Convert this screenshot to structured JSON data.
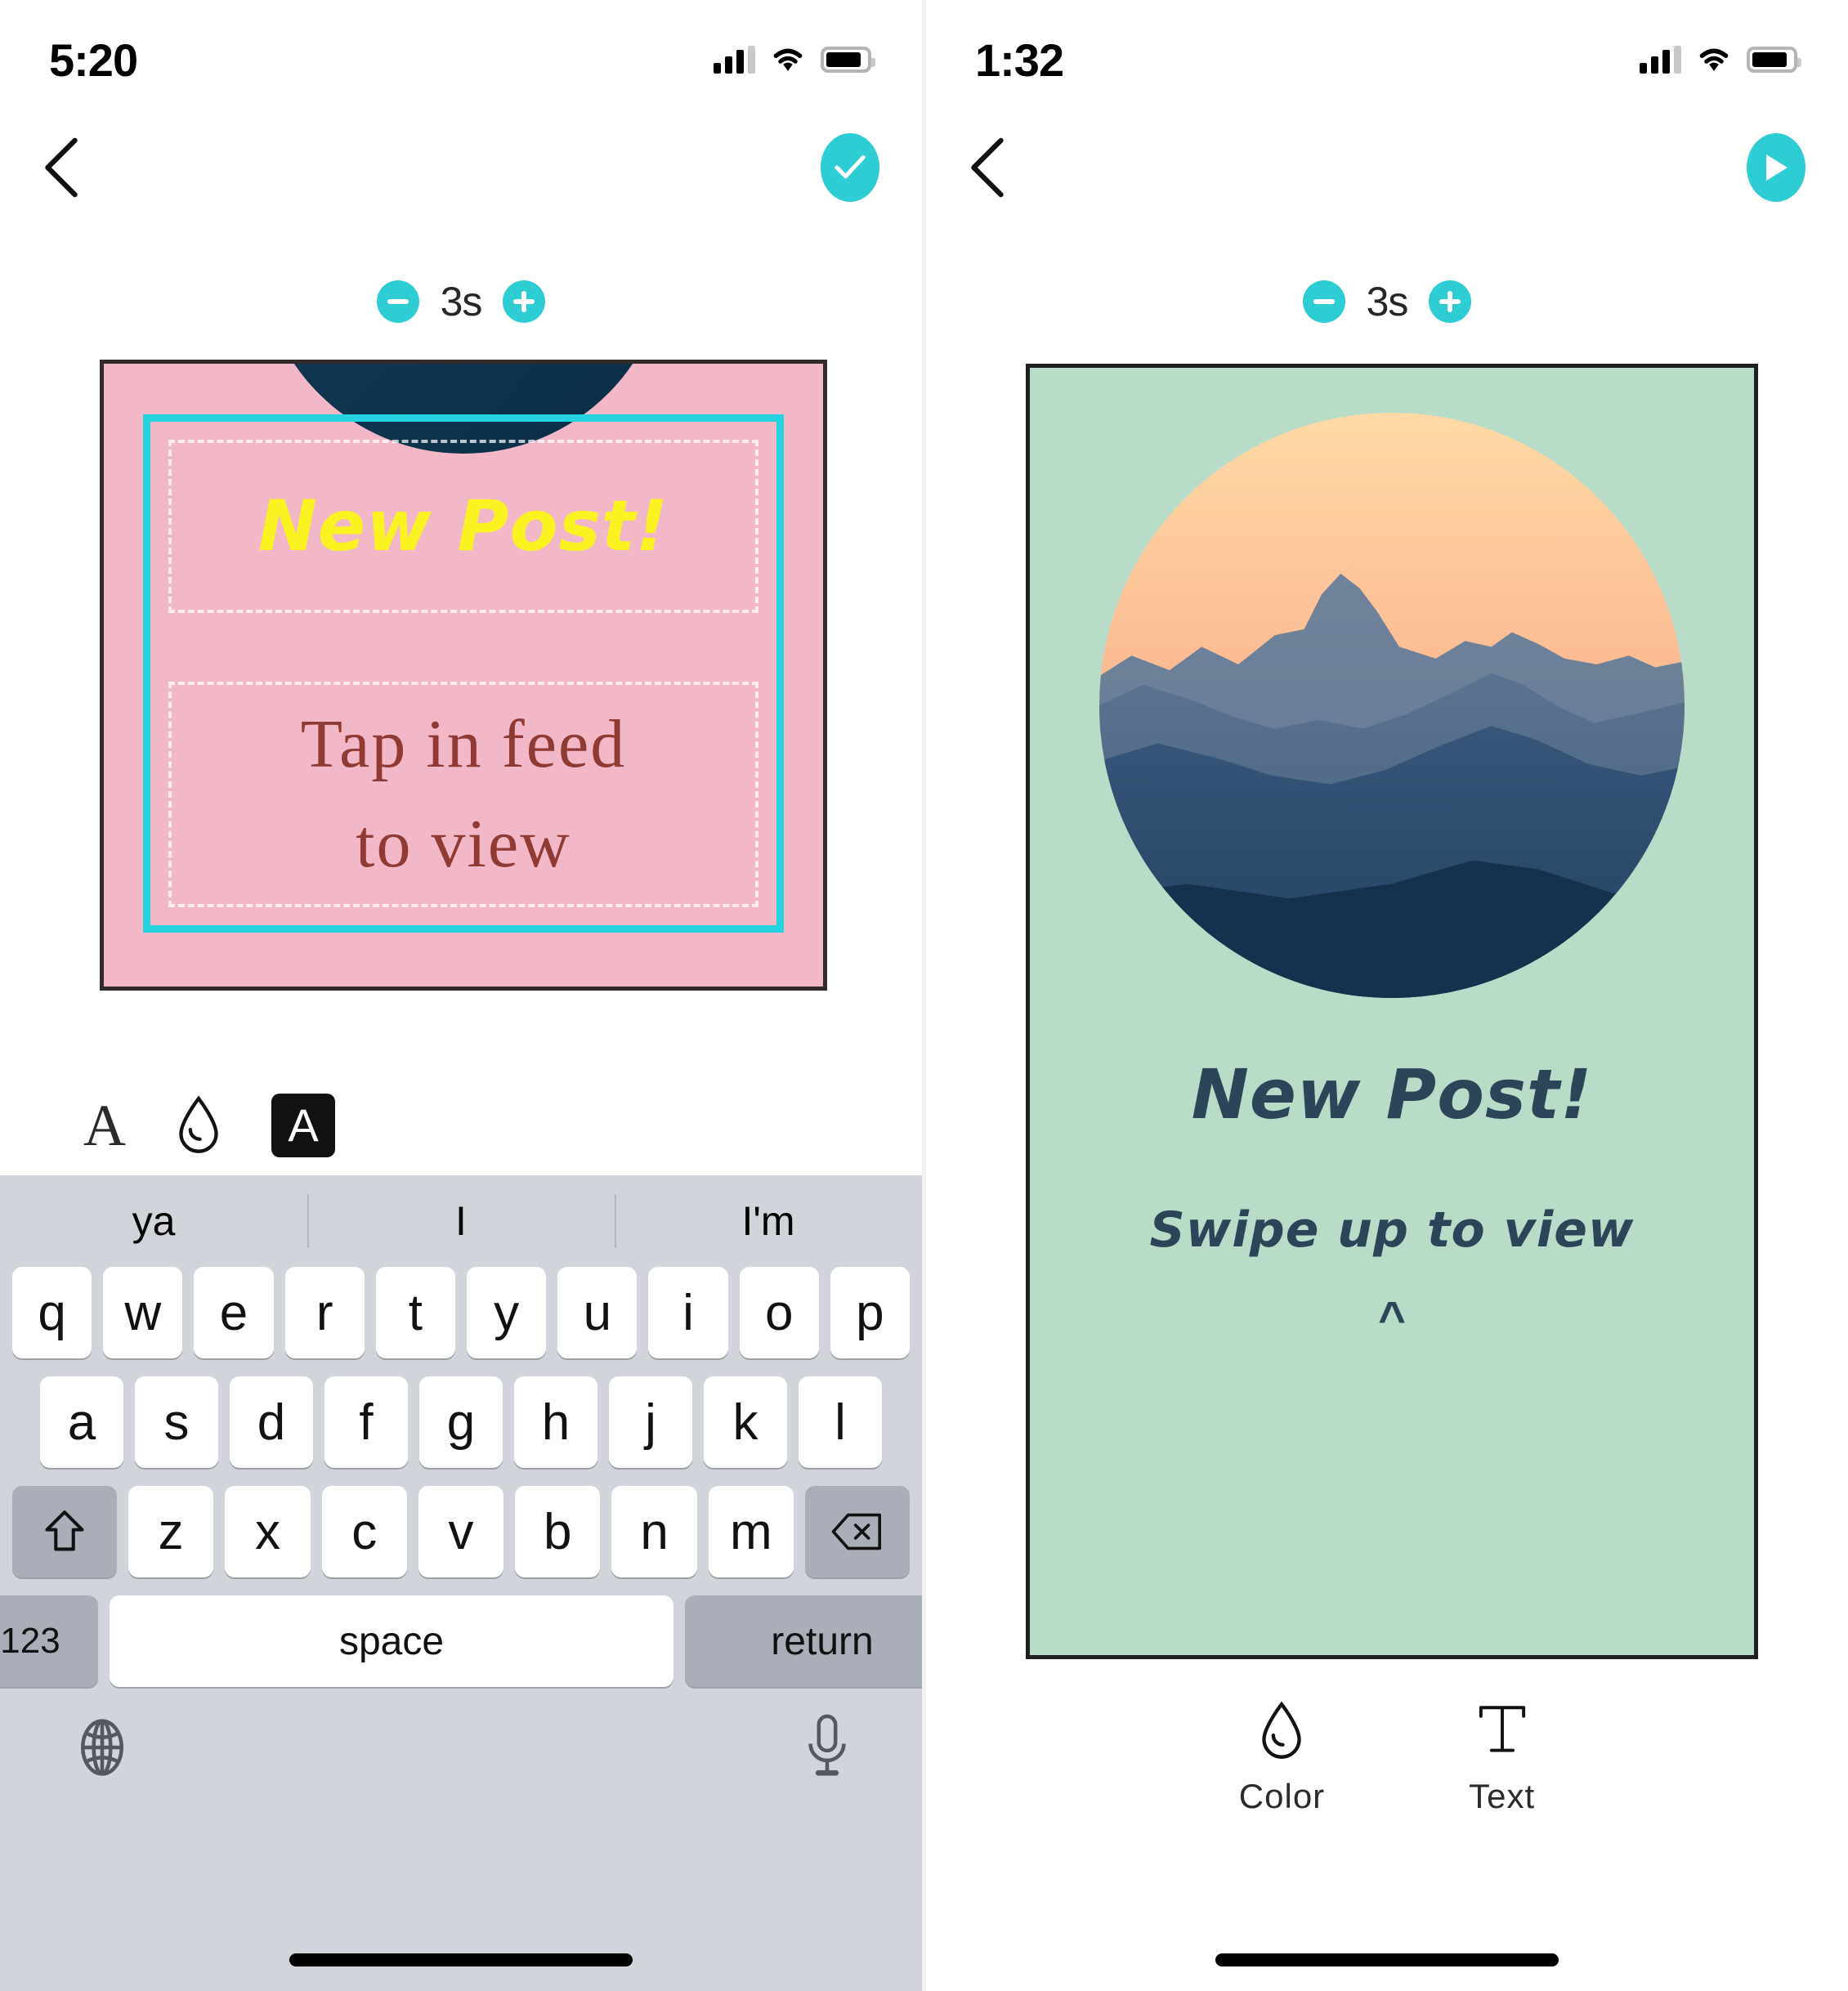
{
  "left": {
    "status": {
      "time": "5:20",
      "signal_icon": "cellular-signal-icon",
      "wifi_icon": "wifi-icon",
      "battery_icon": "battery-icon"
    },
    "nav": {
      "back_icon": "back-chevron-icon",
      "confirm_icon": "check-icon"
    },
    "duration": {
      "decrease_label": "−",
      "value": "3s",
      "increase_label": "+"
    },
    "card": {
      "headline": "New Post!",
      "body_line1": "Tap in feed",
      "body_line2": "to view",
      "background_color": "#F3B8C7",
      "headline_color": "#FBF222",
      "body_color": "#8F3A33",
      "selection_color": "#25D3E0"
    },
    "tools": [
      {
        "name": "font-tool",
        "glyph": "A"
      },
      {
        "name": "color-tool",
        "glyph": "droplet"
      },
      {
        "name": "text-style-tool",
        "glyph": "A"
      }
    ],
    "keyboard": {
      "suggestions": [
        "ya",
        "I",
        "I'm"
      ],
      "row1": [
        "q",
        "w",
        "e",
        "r",
        "t",
        "y",
        "u",
        "i",
        "o",
        "p"
      ],
      "row2": [
        "a",
        "s",
        "d",
        "f",
        "g",
        "h",
        "j",
        "k",
        "l"
      ],
      "row3": [
        "z",
        "x",
        "c",
        "v",
        "b",
        "n",
        "m"
      ],
      "shift_label": "shift",
      "delete_label": "delete",
      "numbers_label": "123",
      "space_label": "space",
      "return_label": "return",
      "globe_icon": "globe-icon",
      "mic_icon": "microphone-icon"
    }
  },
  "right": {
    "status": {
      "time": "1:32",
      "signal_icon": "cellular-signal-icon",
      "wifi_icon": "wifi-icon",
      "battery_icon": "battery-icon"
    },
    "nav": {
      "back_icon": "back-chevron-icon",
      "play_icon": "play-icon"
    },
    "duration": {
      "decrease_label": "−",
      "value": "3s",
      "increase_label": "+"
    },
    "card": {
      "headline": "New Post!",
      "subtext": "Swipe up to view",
      "caret": "^",
      "background_color": "#B9DCC8",
      "text_color": "#2C4558",
      "photo_alt": "mountain-sunset-photo"
    },
    "bottom_tools": [
      {
        "name": "color-tool",
        "label": "Color",
        "icon": "droplet-icon"
      },
      {
        "name": "text-tool",
        "label": "Text",
        "icon": "text-t-icon"
      }
    ]
  },
  "theme": {
    "accent": "#2ECDD3",
    "keyboard_bg": "#D1D4DA",
    "key_bg": "#FFFFFF",
    "fn_key_bg": "#A9AEB8"
  }
}
